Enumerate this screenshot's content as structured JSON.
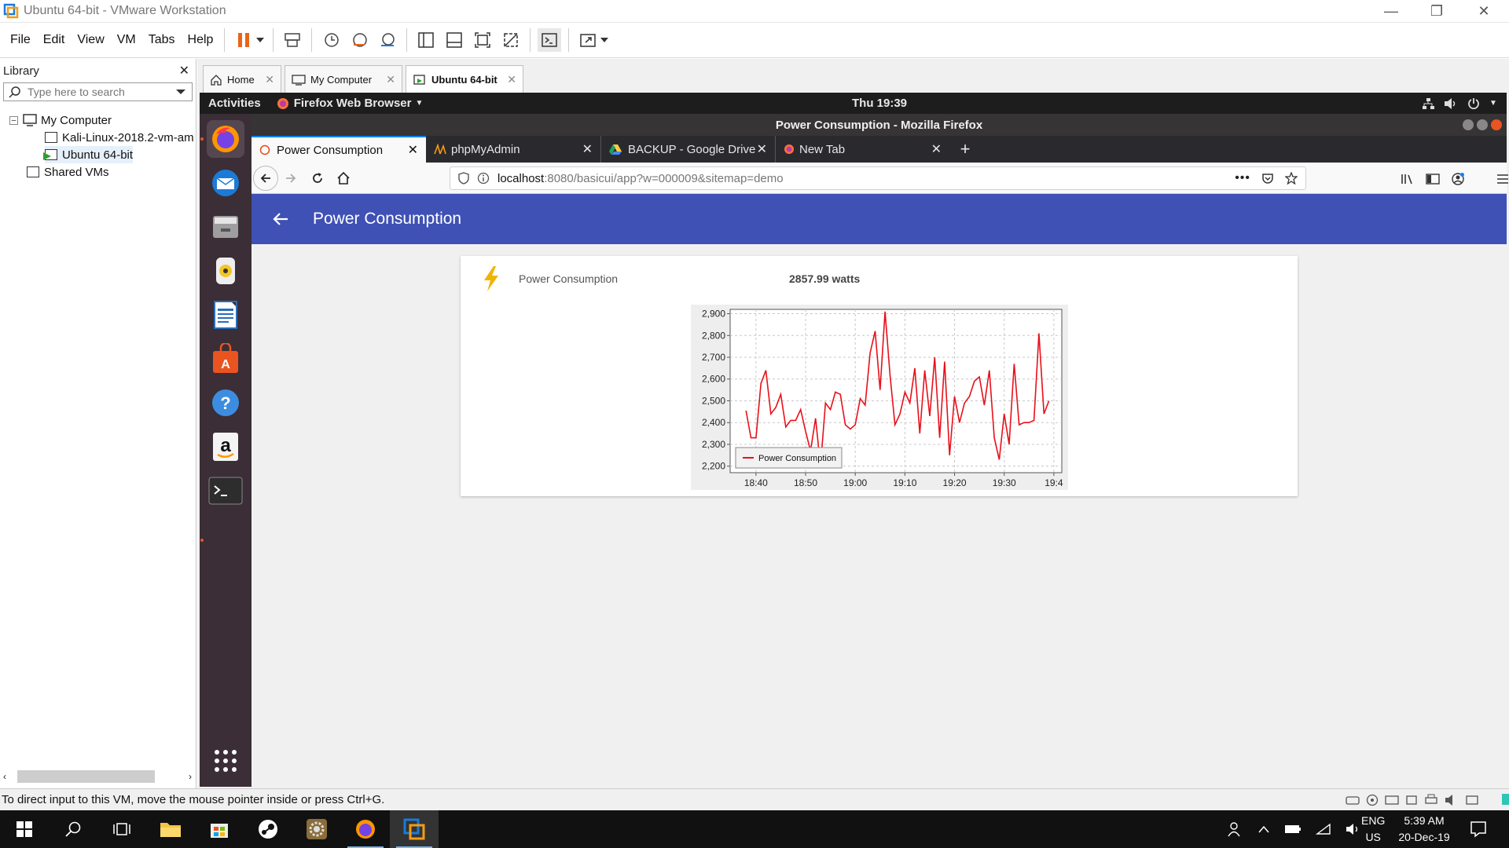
{
  "window": {
    "title": "Ubuntu 64-bit - VMware Workstation"
  },
  "menu": {
    "items": [
      "File",
      "Edit",
      "View",
      "VM",
      "Tabs",
      "Help"
    ]
  },
  "library": {
    "title": "Library",
    "search_placeholder": "Type here to search",
    "tree": {
      "my_computer": "My Computer",
      "vm1": "Kali-Linux-2018.2-vm-am",
      "vm2": "Ubuntu 64-bit",
      "shared": "Shared VMs"
    }
  },
  "vm_tabs": [
    {
      "label": "Home",
      "icon": "home-icon"
    },
    {
      "label": "My Computer",
      "icon": "monitor-icon"
    },
    {
      "label": "Ubuntu 64-bit",
      "icon": "vm-icon"
    }
  ],
  "ubuntu": {
    "activities": "Activities",
    "app_menu": "Firefox Web Browser",
    "clock": "Thu 19:39"
  },
  "firefox": {
    "window_title": "Power Consumption - Mozilla Firefox",
    "tabs": [
      {
        "label": "Power Consumption",
        "active": true
      },
      {
        "label": "phpMyAdmin",
        "active": false
      },
      {
        "label": "BACKUP - Google Drive",
        "active": false
      },
      {
        "label": "New Tab",
        "active": false
      }
    ],
    "url_host": "localhost",
    "url_rest": ":8080/basicui/app?w=000009&sitemap=demo"
  },
  "app": {
    "header_title": "Power Consumption",
    "item_label": "Power Consumption",
    "item_value": "2857.99 watts",
    "accent": "#3f51b5",
    "icon_color": "#f0b400"
  },
  "chart_data": {
    "type": "line",
    "x_ticks": [
      "18:40",
      "18:50",
      "19:00",
      "19:10",
      "19:20",
      "19:30",
      "19:4"
    ],
    "y_ticks": [
      "2,900",
      "2,800",
      "2,700",
      "2,600",
      "2,500",
      "2,400",
      "2,300",
      "2,200"
    ],
    "ylim": [
      2170,
      2920
    ],
    "xlim": [
      18.62,
      19.72
    ],
    "legend": "Power Consumption",
    "legend_position": "bottom-left",
    "grid": true,
    "color": "#e8101a",
    "x": [
      0,
      1,
      2,
      3,
      4,
      5,
      6,
      7,
      8,
      9,
      10,
      11,
      12,
      13,
      14,
      15,
      16,
      17,
      18,
      19,
      20,
      21,
      22,
      23,
      24,
      25,
      26,
      27,
      28,
      29,
      30,
      31,
      32,
      33,
      34,
      35,
      36,
      37,
      38,
      39,
      40,
      41,
      42,
      43,
      44,
      45,
      46,
      47,
      48,
      49,
      50,
      51,
      52,
      53,
      54,
      55,
      56,
      57,
      58,
      59,
      60,
      61,
      62,
      63,
      64,
      65,
      66,
      67,
      68,
      69,
      70,
      71,
      72,
      73,
      74,
      75,
      76,
      77,
      78,
      79,
      80,
      81,
      82,
      83,
      84,
      85,
      86,
      87,
      88,
      89,
      90,
      91,
      92,
      93,
      94,
      95,
      96,
      97,
      98,
      99,
      100,
      101,
      102,
      103,
      104,
      105,
      106,
      107,
      108,
      109,
      110,
      111,
      112,
      113,
      114,
      115,
      116,
      117,
      118,
      119
    ],
    "minutes_offset_start": 0,
    "series": [
      {
        "name": "Power Consumption",
        "points": [
          [
            "18:38",
            2455
          ],
          [
            "18:39",
            2330
          ],
          [
            "18:40",
            2330
          ],
          [
            "18:41",
            2580
          ],
          [
            "18:42",
            2640
          ],
          [
            "18:43",
            2440
          ],
          [
            "18:44",
            2470
          ],
          [
            "18:45",
            2530
          ],
          [
            "18:46",
            2380
          ],
          [
            "18:47",
            2410
          ],
          [
            "18:48",
            2410
          ],
          [
            "18:49",
            2460
          ],
          [
            "18:50",
            2360
          ],
          [
            "18:51",
            2270
          ],
          [
            "18:52",
            2420
          ],
          [
            "18:53",
            2200
          ],
          [
            "18:54",
            2490
          ],
          [
            "18:55",
            2460
          ],
          [
            "18:56",
            2540
          ],
          [
            "18:57",
            2530
          ],
          [
            "18:58",
            2390
          ],
          [
            "18:59",
            2370
          ],
          [
            "19:00",
            2390
          ],
          [
            "19:01",
            2510
          ],
          [
            "19:02",
            2480
          ],
          [
            "19:03",
            2720
          ],
          [
            "19:04",
            2820
          ],
          [
            "19:05",
            2550
          ],
          [
            "19:06",
            2910
          ],
          [
            "19:07",
            2620
          ],
          [
            "19:08",
            2390
          ],
          [
            "19:09",
            2440
          ],
          [
            "19:10",
            2540
          ],
          [
            "19:11",
            2490
          ],
          [
            "19:12",
            2650
          ],
          [
            "19:13",
            2350
          ],
          [
            "19:14",
            2640
          ],
          [
            "19:15",
            2430
          ],
          [
            "19:16",
            2700
          ],
          [
            "19:17",
            2330
          ],
          [
            "19:18",
            2680
          ],
          [
            "19:19",
            2250
          ],
          [
            "19:20",
            2520
          ],
          [
            "19:21",
            2400
          ],
          [
            "19:22",
            2490
          ],
          [
            "19:23",
            2520
          ],
          [
            "19:24",
            2590
          ],
          [
            "19:25",
            2610
          ],
          [
            "19:26",
            2480
          ],
          [
            "19:27",
            2640
          ],
          [
            "19:28",
            2330
          ],
          [
            "19:29",
            2230
          ],
          [
            "19:30",
            2440
          ],
          [
            "19:31",
            2300
          ],
          [
            "19:32",
            2670
          ],
          [
            "19:33",
            2390
          ],
          [
            "19:34",
            2400
          ],
          [
            "19:35",
            2400
          ],
          [
            "19:36",
            2410
          ],
          [
            "19:37",
            2810
          ],
          [
            "19:38",
            2440
          ],
          [
            "19:39",
            2500
          ]
        ]
      }
    ]
  },
  "vm_status": "To direct input to this VM, move the mouse pointer inside or press Ctrl+G.",
  "taskbar": {
    "lang": "ENG",
    "region": "US",
    "time": "5:39 AM",
    "date": "20-Dec-19"
  }
}
